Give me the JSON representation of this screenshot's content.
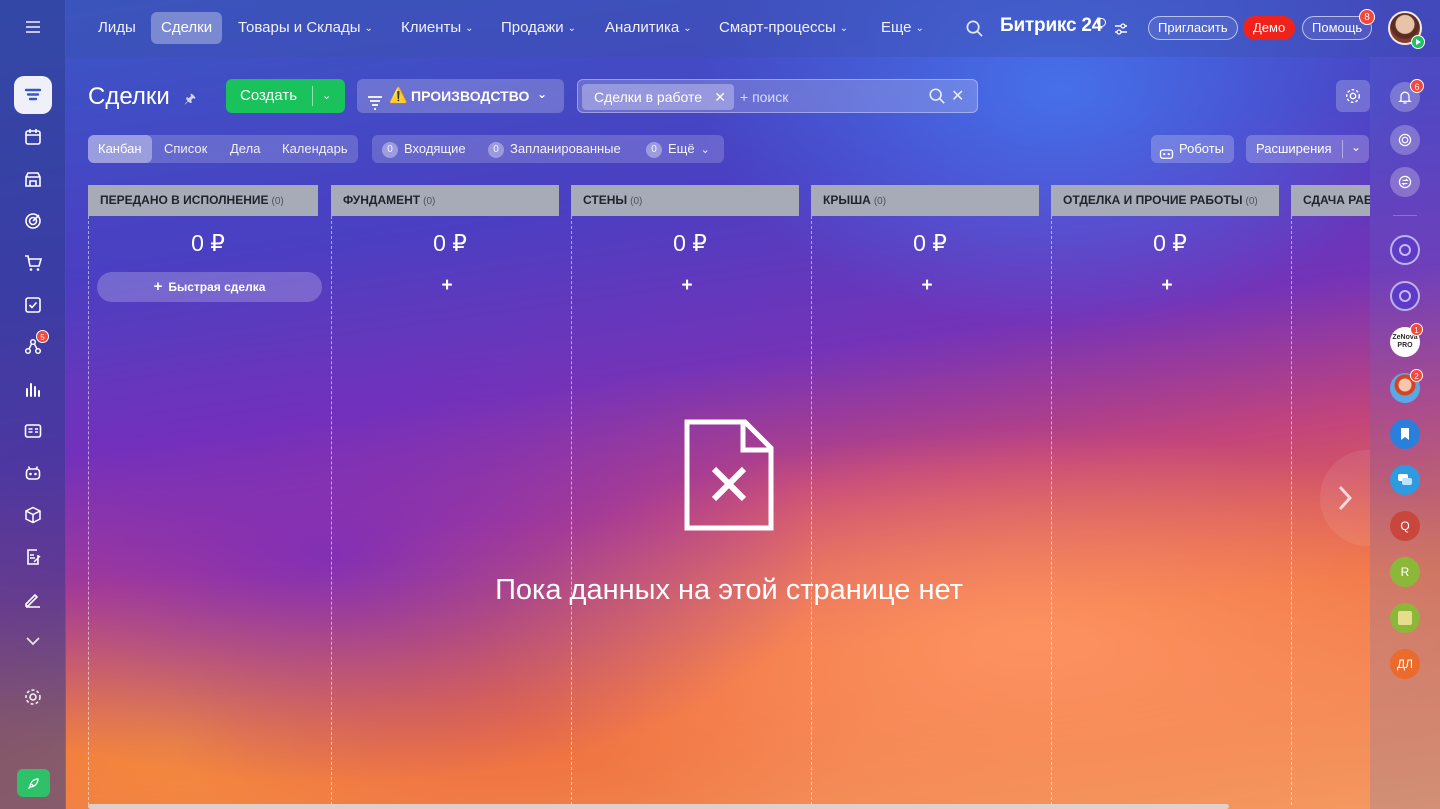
{
  "nav": {
    "items": [
      {
        "label": "Лиды",
        "dropdown": false,
        "active": false
      },
      {
        "label": "Сделки",
        "dropdown": false,
        "active": true
      },
      {
        "label": "Товары и Склады",
        "dropdown": true,
        "active": false
      },
      {
        "label": "Клиенты",
        "dropdown": true,
        "active": false
      },
      {
        "label": "Продажи",
        "dropdown": true,
        "active": false
      },
      {
        "label": "Аналитика",
        "dropdown": true,
        "active": false
      },
      {
        "label": "Смарт-процессы",
        "dropdown": true,
        "active": false
      },
      {
        "label": "Еще",
        "dropdown": true,
        "active": false
      }
    ],
    "brand": "Битрикс 24",
    "invite_label": "Пригласить",
    "demo_label": "Демо",
    "help_label": "Помощь",
    "help_badge": "8"
  },
  "sidebar": {
    "tasks_badge": "5",
    "icons": [
      "crm-icon",
      "calendar-icon",
      "store-icon",
      "target-icon",
      "cart-icon",
      "checkbox-icon",
      "flow-icon",
      "analytics-icon",
      "contact-card-icon",
      "robot-icon",
      "box-icon",
      "document-edit-icon",
      "signature-icon",
      "chevron-down-icon",
      "settings-icon",
      "rocket-icon"
    ]
  },
  "toolbar": {
    "title": "Сделки",
    "create_label": "Создать",
    "funnel_label": "ПРОИЗВОДСТВО",
    "filter_chip": "Сделки в работе",
    "search_placeholder": "+ поиск"
  },
  "views": {
    "items": [
      "Канбан",
      "Список",
      "Дела",
      "Календарь"
    ],
    "active": "Канбан"
  },
  "counters": [
    {
      "count": "0",
      "label": "Входящие"
    },
    {
      "count": "0",
      "label": "Запланированные"
    },
    {
      "count": "0",
      "label": "Ещё"
    }
  ],
  "robots_label": "Роботы",
  "extensions_label": "Расширения",
  "kanban": {
    "columns": [
      {
        "title": "ПЕРЕДАНО В ИСПОЛНЕНИЕ",
        "count": "(0)",
        "sum": "0 ₽",
        "quick_label": "Быстрая сделка"
      },
      {
        "title": "ФУНДАМЕНТ",
        "count": "(0)",
        "sum": "0 ₽"
      },
      {
        "title": "СТЕНЫ",
        "count": "(0)",
        "sum": "0 ₽"
      },
      {
        "title": "КРЫША",
        "count": "(0)",
        "sum": "0 ₽"
      },
      {
        "title": "ОТДЕЛКА И ПРОЧИЕ РАБОТЫ",
        "count": "(0)",
        "sum": "0 ₽"
      },
      {
        "title": "СДАЧА РАБ",
        "count": "",
        "sum": ""
      }
    ],
    "empty_message": "Пока данных на этой странице нет"
  },
  "rightbar": {
    "notifications_badge": "6",
    "avatars": [
      {
        "label": "",
        "badge": ""
      },
      {
        "label": "",
        "badge": ""
      },
      {
        "label": "ZeNova PRO",
        "badge": "1"
      },
      {
        "label": "",
        "badge": "2"
      },
      {
        "label": "",
        "badge": ""
      },
      {
        "label": "",
        "badge": ""
      },
      {
        "label": "Q",
        "badge": ""
      },
      {
        "label": "R",
        "badge": ""
      },
      {
        "label": "",
        "badge": ""
      },
      {
        "label": "ДЛ",
        "badge": ""
      }
    ]
  },
  "colors": {
    "create_green": "#19c25a",
    "demo_red": "#f0231c",
    "column_header": "#a7abb7",
    "badge_red": "#f4473a"
  }
}
